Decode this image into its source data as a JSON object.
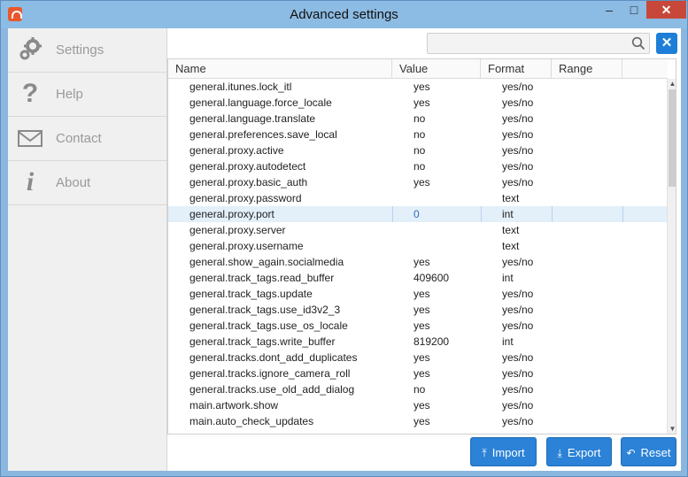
{
  "window": {
    "title": "Advanced settings",
    "minimize": "‒",
    "maximize": "□",
    "close": "✕"
  },
  "sidebar": {
    "items": [
      {
        "label": "Settings",
        "icon": "gear-icon"
      },
      {
        "label": "Help",
        "icon": "question-icon"
      },
      {
        "label": "Contact",
        "icon": "envelope-icon"
      },
      {
        "label": "About",
        "icon": "info-icon"
      }
    ]
  },
  "search": {
    "value": "",
    "placeholder": "",
    "clear": "✕"
  },
  "table": {
    "columns": [
      "Name",
      "Value",
      "Format",
      "Range"
    ],
    "selected_index": 8,
    "rows": [
      [
        "general.itunes.lock_itl",
        "yes",
        "yes/no"
      ],
      [
        "general.language.force_locale",
        "yes",
        "yes/no"
      ],
      [
        "general.language.translate",
        "no",
        "yes/no"
      ],
      [
        "general.preferences.save_local",
        "no",
        "yes/no"
      ],
      [
        "general.proxy.active",
        "no",
        "yes/no"
      ],
      [
        "general.proxy.autodetect",
        "no",
        "yes/no"
      ],
      [
        "general.proxy.basic_auth",
        "yes",
        "yes/no"
      ],
      [
        "general.proxy.password",
        "",
        "text"
      ],
      [
        "general.proxy.port",
        "0",
        "int"
      ],
      [
        "general.proxy.server",
        "",
        "text"
      ],
      [
        "general.proxy.username",
        "",
        "text"
      ],
      [
        "general.show_again.socialmedia",
        "yes",
        "yes/no"
      ],
      [
        "general.track_tags.read_buffer",
        "409600",
        "int"
      ],
      [
        "general.track_tags.update",
        "yes",
        "yes/no"
      ],
      [
        "general.track_tags.use_id3v2_3",
        "yes",
        "yes/no"
      ],
      [
        "general.track_tags.use_os_locale",
        "yes",
        "yes/no"
      ],
      [
        "general.track_tags.write_buffer",
        "819200",
        "int"
      ],
      [
        "general.tracks.dont_add_duplicates",
        "yes",
        "yes/no"
      ],
      [
        "general.tracks.ignore_camera_roll",
        "yes",
        "yes/no"
      ],
      [
        "general.tracks.use_old_add_dialog",
        "no",
        "yes/no"
      ],
      [
        "main.artwork.show",
        "yes",
        "yes/no"
      ],
      [
        "main.auto_check_updates",
        "yes",
        "yes/no"
      ]
    ]
  },
  "buttons": {
    "import": "Import",
    "export": "Export",
    "reset": "Reset"
  },
  "colors": {
    "accent": "#2b82d6",
    "titlebar": "#8cbbe3",
    "close": "#c7483a",
    "selected_row": "#e3eff9"
  }
}
